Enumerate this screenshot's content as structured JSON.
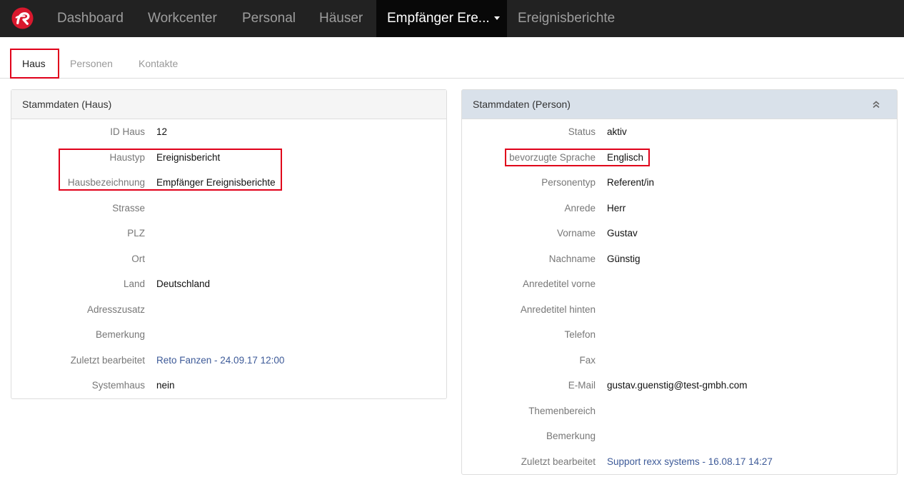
{
  "navbar": {
    "logo": "rexx-logo-icon",
    "items": [
      "Dashboard",
      "Workcenter",
      "Personal",
      "Häuser"
    ],
    "active_item": "Empfänger Ere...",
    "items_after": [
      "Ereignisberichte"
    ]
  },
  "subtabs": [
    {
      "label": "Haus",
      "active": true
    },
    {
      "label": "Personen",
      "active": false
    },
    {
      "label": "Kontakte",
      "active": false
    }
  ],
  "haus_panel": {
    "title": "Stammdaten (Haus)",
    "rows": [
      {
        "label": "ID Haus",
        "value": "12"
      },
      {
        "label": "Haustyp",
        "value": "Ereignisbericht"
      },
      {
        "label": "Hausbezeichnung",
        "value": "Empfänger Ereignisberichte"
      },
      {
        "label": "Strasse",
        "value": ""
      },
      {
        "label": "PLZ",
        "value": ""
      },
      {
        "label": "Ort",
        "value": ""
      },
      {
        "label": "Land",
        "value": "Deutschland"
      },
      {
        "label": "Adresszusatz",
        "value": ""
      },
      {
        "label": "Bemerkung",
        "value": ""
      },
      {
        "label": "Zuletzt bearbeitet",
        "value": "Reto Fanzen - 24.09.17 12:00"
      },
      {
        "label": "Systemhaus",
        "value": "nein"
      }
    ]
  },
  "person_panel": {
    "title": "Stammdaten (Person)",
    "collapse_icon": "double-chevron-up-icon",
    "rows": [
      {
        "label": "Status",
        "value": "aktiv"
      },
      {
        "label": "bevorzugte Sprache",
        "value": "Englisch"
      },
      {
        "label": "Personentyp",
        "value": "Referent/in"
      },
      {
        "label": "Anrede",
        "value": "Herr"
      },
      {
        "label": "Vorname",
        "value": "Gustav"
      },
      {
        "label": "Nachname",
        "value": "Günstig"
      },
      {
        "label": "Anredetitel vorne",
        "value": ""
      },
      {
        "label": "Anredetitel hinten",
        "value": ""
      },
      {
        "label": "Telefon",
        "value": ""
      },
      {
        "label": "Fax",
        "value": ""
      },
      {
        "label": "E-Mail",
        "value": "gustav.guenstig@test-gmbh.com"
      },
      {
        "label": "Themenbereich",
        "value": ""
      },
      {
        "label": "Bemerkung",
        "value": ""
      },
      {
        "label": "Zuletzt bearbeitet",
        "value": "Support rexx systems - 16.08.17 14:27"
      }
    ]
  },
  "colors": {
    "highlight": "#e0001a",
    "navbar": "#222222",
    "link": "#3d5a98",
    "logo": "#d9182d"
  }
}
